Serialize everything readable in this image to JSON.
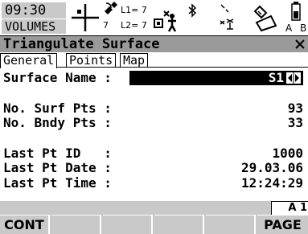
{
  "status": {
    "time": "09:30",
    "mode": "VOLUMES",
    "l1_label": "L1=",
    "l1_value": "7",
    "l2_label": "L2=",
    "l2_value": "7",
    "l2_sats": "7",
    "indicator_a": "A",
    "indicator_b": "B",
    "icons": [
      "position-cross-icon",
      "satellite-icon",
      "antenna-rover-icon",
      "bluetooth-icon",
      "radio-icon",
      "memory-card-icon",
      "battery-icon"
    ]
  },
  "title": "Triangulate Surface",
  "tabs": [
    {
      "label": "General",
      "active": true
    },
    {
      "label": "Points",
      "active": false
    },
    {
      "label": "Map",
      "active": false
    }
  ],
  "fields": {
    "surface_name_label": "Surface Name :",
    "surface_name_value": "S1",
    "surf_pts_label": "No. Surf Pts :",
    "surf_pts_value": "93",
    "bndy_pts_label": "No. Bndy Pts :",
    "bndy_pts_value": "33",
    "last_pt_id_label": "Last Pt ID   :",
    "last_pt_id_value": "1000",
    "last_pt_date_label": "Last Pt Date :",
    "last_pt_date_value": "29.03.06",
    "last_pt_time_label": "Last Pt Time :",
    "last_pt_time_value": "12:24:29"
  },
  "page_indicator": "A 1",
  "fkeys": {
    "f1": "CONT",
    "f2": "",
    "f3": "",
    "f4": "",
    "f5": "",
    "f6": "PAGE"
  },
  "colors": {
    "status_grey": "#c9c9c9",
    "title_grey": "#9a9a9a",
    "highlight": "#000000"
  }
}
